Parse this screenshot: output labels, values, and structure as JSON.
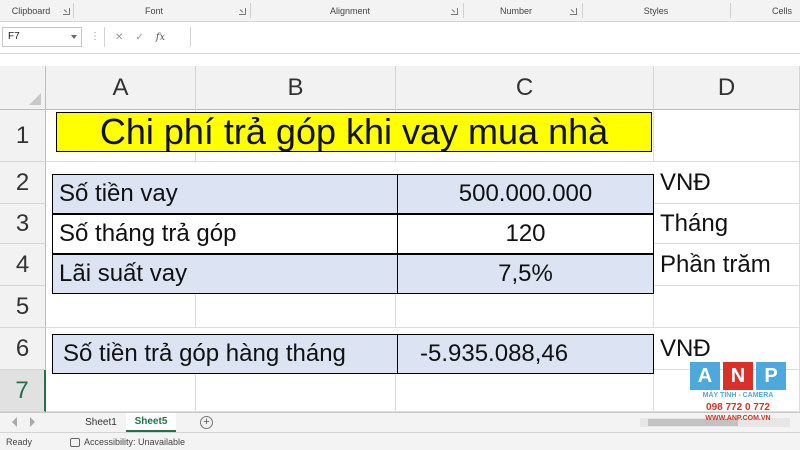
{
  "ribbon": {
    "groups": [
      {
        "label": "Clipboard"
      },
      {
        "label": "Font"
      },
      {
        "label": "Alignment"
      },
      {
        "label": "Number"
      },
      {
        "label": "Styles"
      },
      {
        "label": "Cells"
      }
    ]
  },
  "formula_bar": {
    "name_box": "F7",
    "cancel_glyph": "✕",
    "enter_glyph": "✓",
    "fx_glyph": "fx",
    "value": ""
  },
  "columns": [
    "A",
    "B",
    "C",
    "D"
  ],
  "rows": [
    "1",
    "2",
    "3",
    "4",
    "5",
    "6",
    "7"
  ],
  "selected_row": "7",
  "sheet": {
    "title": "Chi phí trả góp khi vay mua nhà",
    "loan_label": "Số tiền vay",
    "loan_value": "500.000.000",
    "loan_unit": "VNĐ",
    "months_label": "Số tháng trả góp",
    "months_value": "120",
    "months_unit": "Tháng",
    "rate_label": "Lãi suất vay",
    "rate_value": "7,5%",
    "rate_unit": "Phần trăm",
    "payment_label": "Số tiền trả góp hàng tháng",
    "payment_value": "-5.935.088,46",
    "payment_unit": "VNĐ"
  },
  "tabs": [
    {
      "label": "Sheet1",
      "active": false
    },
    {
      "label": "Sheet5",
      "active": true
    }
  ],
  "status": {
    "ready": "Ready",
    "accessibility": "Accessibility: Unavailable"
  },
  "logo": {
    "letters": [
      "A",
      "N",
      "P"
    ],
    "tagline": "MÁY TÍNH - CAMERA",
    "phone": "098 772 0 772",
    "website": "WWW.ANP.COM.VN"
  },
  "colors": {
    "excel_green": "#217346",
    "title_fill": "#ffff00",
    "cell_fill_blue": "#dce3f2",
    "logo_blue": "#4da9dc",
    "logo_red": "#d9302a"
  }
}
